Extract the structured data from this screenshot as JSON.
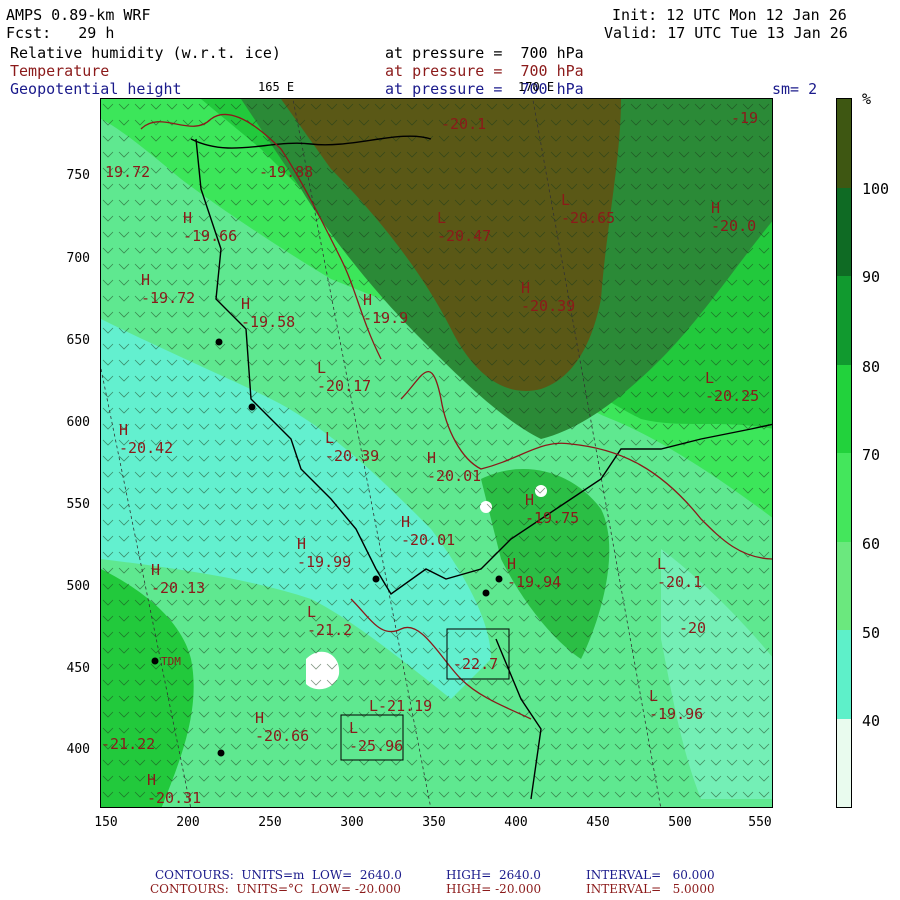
{
  "header": {
    "model": "AMPS 0.89-km WRF",
    "fcst": "Fcst:   29 h",
    "init": "Init: 12 UTC Mon 12 Jan 26",
    "valid": "Valid: 17 UTC Tue 13 Jan 26",
    "field1": "Relative humidity (w.r.t. ice)",
    "field2": "Temperature",
    "field3": "Geopotential height",
    "pressure1": "at pressure =  700 hPa",
    "pressure2": "at pressure =  700 hPa",
    "pressure3": "at pressure =  700 hPa",
    "lon_mark1": "165 E",
    "lon_mark2": "170 E",
    "smoothing": "sm= 2"
  },
  "axes": {
    "y_ticks": [
      "750",
      "700",
      "650",
      "600",
      "550",
      "500",
      "450",
      "400"
    ],
    "x_ticks": [
      "150",
      "200",
      "250",
      "300",
      "350",
      "400",
      "450",
      "500",
      "550"
    ]
  },
  "colorbar": {
    "unit": "%",
    "levels": [
      "40",
      "50",
      "60",
      "70",
      "80",
      "90",
      "100"
    ],
    "colors": [
      "#e9fbee",
      "#5ef0c9",
      "#6be87e",
      "#44e65c",
      "#22d23c",
      "#119a2f",
      "#0f6b24",
      "#3e5712"
    ]
  },
  "field_colors": {
    "very_high": "#5a5816",
    "high": "#2b8a37",
    "mid_high": "#22c93c",
    "mid": "#3ce65a",
    "low": "#5fe890",
    "dry": "#63f0cf",
    "snow": "#ffffff",
    "temperature_contour": "#8b1a1a",
    "coast": "#000000"
  },
  "labels": {
    "temps": [
      {
        "mark": "H",
        "value": "19.72"
      },
      {
        "mark": "",
        "value": "-20.1"
      },
      {
        "mark": "",
        "value": "-19"
      },
      {
        "mark": "",
        "value": "-19.88"
      },
      {
        "mark": "H",
        "value": "-19.66"
      },
      {
        "mark": "L",
        "value": "-20.47"
      },
      {
        "mark": "L",
        "value": "-20.65"
      },
      {
        "mark": "H",
        "value": "-20.0"
      },
      {
        "mark": "H",
        "value": "-19.72"
      },
      {
        "mark": "H",
        "value": "-19.58"
      },
      {
        "mark": "H",
        "value": "-19.9"
      },
      {
        "mark": "H",
        "value": "-20.39"
      },
      {
        "mark": "L",
        "value": "-20.17"
      },
      {
        "mark": "L",
        "value": "-20.25"
      },
      {
        "mark": "H",
        "value": "-20.42"
      },
      {
        "mark": "L",
        "value": "-20.39"
      },
      {
        "mark": "H",
        "value": "-20.01"
      },
      {
        "mark": "H",
        "value": "-19.75"
      },
      {
        "mark": "H",
        "value": "-20.01"
      },
      {
        "mark": "H",
        "value": "-19.99"
      },
      {
        "mark": "H",
        "value": "-19.94"
      },
      {
        "mark": "H",
        "value": "-20.13"
      },
      {
        "mark": "L",
        "value": "-20.1"
      },
      {
        "mark": "L",
        "value": "-21.2"
      },
      {
        "mark": "",
        "value": "-20"
      },
      {
        "mark": "",
        "value": "-22.7"
      },
      {
        "mark": "L",
        "value": "-21.19"
      },
      {
        "mark": "H",
        "value": "-20.66"
      },
      {
        "mark": "L",
        "value": "-25.96"
      },
      {
        "mark": "L",
        "value": "-19.96"
      },
      {
        "mark": "",
        "value": "-21.22"
      },
      {
        "mark": "H",
        "value": "-20.31"
      }
    ],
    "station": "TDM"
  },
  "footer": {
    "line1": {
      "a": "CONTOURS:  UNITS=m  LOW=  2640.0",
      "b": "HIGH=  2640.0",
      "c": "INTERVAL=   60.000"
    },
    "line2": {
      "a": "CONTOURS:  UNITS=°C  LOW= -20.000",
      "b": "HIGH= -20.000",
      "c": "INTERVAL=   5.0000"
    }
  }
}
